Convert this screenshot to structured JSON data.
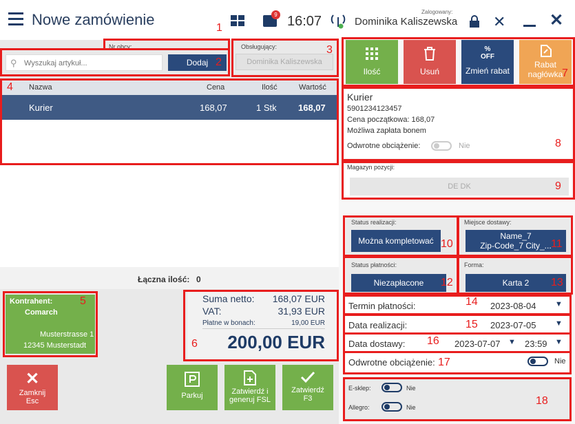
{
  "header": {
    "title": "Nowe zamówienie",
    "badge": "9",
    "time": "16:07",
    "user_caption": "Zalogowany:",
    "user": "Dominika Kaliszewska"
  },
  "search": {
    "nr_obcy_label": "Nr obcy:",
    "placeholder": "Wyszukaj artykuł...",
    "add_label": "Dodaj",
    "service_label": "Obsługujący:",
    "service_value": "Dominika Kaliszewska"
  },
  "table": {
    "columns": [
      "Nazwa",
      "Cena",
      "Ilość",
      "Wartość"
    ],
    "rows": [
      {
        "name": "Kurier",
        "price": "168,07",
        "qty": "1 Stk",
        "value": "168,07"
      }
    ]
  },
  "summary": {
    "qty_label": "Łączna ilość:",
    "qty_value": "0"
  },
  "client": {
    "label": "Kontrahent:",
    "name": "Comarch",
    "street": "Musterstrasse 1",
    "city": "12345 Musterstadt"
  },
  "totals": {
    "net_label": "Suma netto:",
    "net_value": "168,07 EUR",
    "vat_label": "VAT:",
    "vat_value": "31,93 EUR",
    "bon_label": "Płatne w bonach:",
    "bon_value": "19,00 EUR",
    "total": "200,00 EUR"
  },
  "bottom_buttons": {
    "close": "Zamknij",
    "close_key": "Esc",
    "park": "Parkuj",
    "confirm_fsl_1": "Zatwierdź i",
    "confirm_fsl_2": "generuj FSL",
    "confirm": "Zatwierdź",
    "confirm_key": "F3"
  },
  "actions": {
    "qty": "Ilość",
    "delete": "Usuń",
    "change_discount": "Zmień rabat",
    "off_text": "OFF",
    "header_discount_1": "Rabat",
    "header_discount_2": "nagłówka"
  },
  "product": {
    "name": "Kurier",
    "ean": "5901234123457",
    "start_price": "Cena początkowa: 168,07",
    "voucher": "Możliwa zapłata bonem",
    "reverse_label": "Odwrotne obciążenie:",
    "reverse_value": "Nie"
  },
  "warehouse": {
    "label": "Magazyn pozycji:",
    "value": "DE DK"
  },
  "status": {
    "realization_label": "Status realizacji:",
    "realization_value": "Można kompletować",
    "delivery_place_label": "Miejsce dostawy:",
    "delivery_place_line1": "Name_7",
    "delivery_place_line2": "Zip-Code_7 City_...",
    "payment_label": "Status płatności:",
    "payment_value": "Niezapłacone",
    "form_label": "Forma:",
    "form_value": "Karta 2"
  },
  "dates": {
    "payment_due_label": "Termin płatności:",
    "payment_due": "2023-08-04",
    "realization_label": "Data realizacji:",
    "realization": "2023-07-05",
    "delivery_label": "Data dostawy:",
    "delivery_date": "2023-07-07",
    "delivery_time": "23:59",
    "reverse_label": "Odwrotne obciążenie:",
    "reverse_value": "Nie"
  },
  "channels": {
    "eshop_label": "E-sklep:",
    "eshop_value": "Nie",
    "allegro_label": "Allegro:",
    "allegro_value": "Nie"
  },
  "annotations": [
    "1",
    "2",
    "3",
    "4",
    "5",
    "6",
    "7",
    "8",
    "9",
    "10",
    "11",
    "12",
    "13",
    "14",
    "15",
    "16",
    "17",
    "18"
  ],
  "colors": {
    "navy": "#2a4a7c",
    "green": "#74b04b",
    "red": "#d9534f",
    "orange": "#f0a555",
    "annotation": "#e81d1d"
  }
}
